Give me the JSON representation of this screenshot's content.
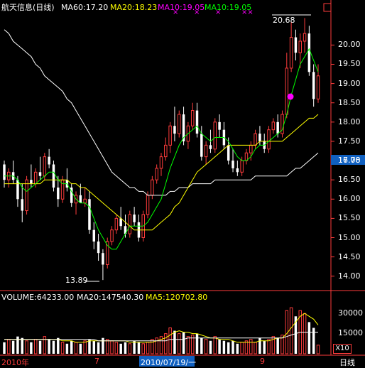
{
  "header": {
    "stock_title": "航天信息(日线)",
    "ma60": "MA60:17.20",
    "ma20": "MA20:18.23",
    "ma10a": "MA10:19.05",
    "ma10b": "MA10:19.05"
  },
  "price_axis": {
    "labels": [
      "20.00",
      "19.50",
      "19.00",
      "18.50",
      "18.00",
      "17.50",
      "17.00",
      "16.50",
      "16.00",
      "15.50",
      "15.00",
      "14.50",
      "14.00"
    ],
    "current": "16.78"
  },
  "annotations": {
    "high": "20.68",
    "low": "13.89"
  },
  "volume_header": {
    "volume": "VOLUME:64233.00",
    "ma20": "MA20:147540.30",
    "ma5": "MA5:120702.80"
  },
  "volume_axis": {
    "labels": [
      "30000",
      "15000"
    ],
    "unit_button": "X10"
  },
  "x_axis": {
    "labels": [
      "2010年",
      "7",
      "2010/07/19/一",
      "9"
    ],
    "period_button": "日线"
  },
  "colors": {
    "up": "#ff3c3c",
    "down": "#ffffff",
    "ma_white": "#ffffff",
    "ma_yellow": "#ffff00",
    "ma_green": "#00ff00",
    "magenta": "#ff00ff",
    "cyan": "#00ffff",
    "current_bg": "#1060c0"
  },
  "chart_data": {
    "type": "candlestick",
    "ylim": [
      13.7,
      20.8
    ],
    "candles": [
      [
        16.9,
        17.0,
        16.3,
        16.5
      ],
      [
        16.5,
        16.8,
        16.3,
        16.7
      ],
      [
        16.7,
        17.0,
        16.4,
        16.5
      ],
      [
        16.5,
        16.6,
        15.8,
        16.0
      ],
      [
        16.0,
        16.4,
        15.4,
        15.7
      ],
      [
        15.7,
        16.6,
        15.6,
        16.5
      ],
      [
        16.5,
        16.9,
        16.3,
        16.4
      ],
      [
        16.4,
        16.8,
        16.3,
        16.7
      ],
      [
        16.7,
        17.1,
        16.5,
        16.6
      ],
      [
        16.6,
        17.2,
        16.5,
        17.1
      ],
      [
        17.1,
        17.3,
        16.8,
        16.9
      ],
      [
        16.9,
        17.0,
        16.2,
        16.3
      ],
      [
        16.3,
        16.6,
        15.8,
        16.0
      ],
      [
        16.0,
        16.6,
        15.9,
        16.5
      ],
      [
        16.5,
        16.8,
        16.2,
        16.3
      ],
      [
        16.3,
        16.4,
        15.8,
        15.9
      ],
      [
        15.9,
        16.2,
        15.6,
        16.1
      ],
      [
        16.1,
        16.4,
        15.9,
        15.9
      ],
      [
        15.9,
        16.3,
        15.8,
        16.0
      ],
      [
        16.0,
        16.2,
        15.1,
        15.2
      ],
      [
        15.2,
        15.4,
        14.7,
        14.9
      ],
      [
        14.9,
        15.1,
        14.4,
        14.6
      ],
      [
        14.6,
        14.7,
        13.9,
        14.3
      ],
      [
        14.3,
        15.0,
        14.2,
        14.9
      ],
      [
        14.9,
        15.3,
        14.8,
        15.2
      ],
      [
        15.2,
        15.6,
        15.1,
        15.5
      ],
      [
        15.5,
        15.8,
        15.2,
        15.3
      ],
      [
        15.3,
        15.6,
        15.0,
        15.1
      ],
      [
        15.1,
        15.7,
        15.0,
        15.6
      ],
      [
        15.6,
        15.8,
        15.3,
        15.4
      ],
      [
        15.4,
        15.6,
        14.9,
        15.0
      ],
      [
        15.0,
        15.7,
        14.9,
        15.6
      ],
      [
        15.6,
        16.2,
        15.5,
        16.1
      ],
      [
        16.1,
        16.6,
        16.0,
        16.5
      ],
      [
        16.5,
        16.9,
        16.4,
        16.8
      ],
      [
        16.8,
        17.2,
        16.6,
        17.1
      ],
      [
        17.1,
        17.6,
        17.0,
        17.4
      ],
      [
        17.4,
        18.0,
        17.2,
        17.9
      ],
      [
        17.9,
        18.4,
        17.5,
        17.7
      ],
      [
        17.7,
        18.3,
        17.6,
        18.2
      ],
      [
        18.2,
        18.4,
        17.4,
        17.5
      ],
      [
        17.5,
        18.0,
        17.3,
        17.9
      ],
      [
        17.9,
        18.5,
        17.8,
        18.3
      ],
      [
        18.3,
        18.5,
        17.6,
        17.7
      ],
      [
        17.7,
        17.9,
        17.0,
        17.1
      ],
      [
        17.1,
        17.5,
        16.9,
        17.4
      ],
      [
        17.4,
        17.8,
        17.2,
        17.3
      ],
      [
        17.3,
        18.1,
        17.2,
        18.0
      ],
      [
        18.0,
        18.2,
        17.6,
        17.8
      ],
      [
        17.8,
        18.0,
        17.3,
        17.4
      ],
      [
        17.4,
        17.6,
        16.9,
        17.0
      ],
      [
        17.0,
        17.3,
        16.7,
        16.8
      ],
      [
        16.8,
        17.0,
        16.6,
        16.7
      ],
      [
        16.7,
        17.1,
        16.6,
        17.0
      ],
      [
        17.0,
        17.3,
        16.9,
        17.2
      ],
      [
        17.2,
        17.5,
        17.0,
        17.4
      ],
      [
        17.4,
        17.8,
        17.3,
        17.7
      ],
      [
        17.7,
        17.9,
        17.4,
        17.5
      ],
      [
        17.5,
        17.7,
        17.2,
        17.3
      ],
      [
        17.3,
        17.9,
        17.2,
        17.8
      ],
      [
        17.8,
        18.1,
        17.7,
        18.0
      ],
      [
        18.0,
        18.2,
        17.6,
        17.7
      ],
      [
        17.7,
        18.3,
        17.6,
        18.2
      ],
      [
        18.2,
        19.8,
        18.1,
        19.4
      ],
      [
        19.4,
        20.6,
        19.3,
        20.2
      ],
      [
        20.2,
        20.4,
        19.6,
        19.8
      ],
      [
        19.8,
        20.3,
        19.4,
        20.1
      ],
      [
        20.1,
        20.7,
        19.8,
        20.3
      ],
      [
        20.3,
        20.5,
        19.2,
        19.3
      ],
      [
        19.3,
        19.5,
        18.4,
        18.6
      ],
      [
        18.6,
        19.5,
        18.5,
        19.2
      ]
    ],
    "ma5_price": [
      16.6,
      16.6,
      16.6,
      16.5,
      16.3,
      16.2,
      16.3,
      16.4,
      16.5,
      16.6,
      16.7,
      16.7,
      16.5,
      16.4,
      16.4,
      16.2,
      16.0,
      15.9,
      15.9,
      15.8,
      15.5,
      15.2,
      15.0,
      14.8,
      14.7,
      14.7,
      14.9,
      15.1,
      15.3,
      15.3,
      15.3,
      15.3,
      15.4,
      15.6,
      15.8,
      16.0,
      16.4,
      16.8,
      17.1,
      17.4,
      17.6,
      17.7,
      17.8,
      17.9,
      17.7,
      17.6,
      17.5,
      17.6,
      17.6,
      17.6,
      17.5,
      17.3,
      17.1,
      17.0,
      17.0,
      17.1,
      17.3,
      17.4,
      17.4,
      17.5,
      17.6,
      17.7,
      17.8,
      18.2,
      18.7,
      19.1,
      19.5,
      19.7,
      19.9,
      19.6,
      19.3
    ],
    "ma20_price": [
      16.4,
      16.4,
      16.4,
      16.4,
      16.4,
      16.4,
      16.4,
      16.4,
      16.4,
      16.5,
      16.5,
      16.5,
      16.5,
      16.5,
      16.5,
      16.4,
      16.4,
      16.3,
      16.3,
      16.2,
      16.1,
      16.0,
      15.9,
      15.8,
      15.7,
      15.6,
      15.5,
      15.4,
      15.3,
      15.2,
      15.2,
      15.2,
      15.2,
      15.2,
      15.3,
      15.4,
      15.5,
      15.6,
      15.8,
      15.9,
      16.1,
      16.3,
      16.5,
      16.7,
      16.8,
      16.9,
      17.0,
      17.1,
      17.2,
      17.3,
      17.4,
      17.4,
      17.4,
      17.4,
      17.4,
      17.4,
      17.4,
      17.5,
      17.5,
      17.5,
      17.5,
      17.5,
      17.5,
      17.6,
      17.7,
      17.8,
      17.9,
      18.0,
      18.1,
      18.1,
      18.2
    ],
    "ma60_price": [
      20.4,
      20.3,
      20.1,
      20.0,
      19.9,
      19.8,
      19.7,
      19.5,
      19.4,
      19.2,
      19.1,
      19.0,
      18.9,
      18.8,
      18.6,
      18.5,
      18.3,
      18.1,
      17.9,
      17.7,
      17.5,
      17.3,
      17.1,
      16.9,
      16.7,
      16.6,
      16.5,
      16.4,
      16.3,
      16.3,
      16.2,
      16.2,
      16.1,
      16.1,
      16.1,
      16.1,
      16.1,
      16.2,
      16.2,
      16.3,
      16.3,
      16.3,
      16.4,
      16.4,
      16.4,
      16.4,
      16.4,
      16.5,
      16.5,
      16.5,
      16.5,
      16.5,
      16.5,
      16.5,
      16.5,
      16.5,
      16.6,
      16.6,
      16.6,
      16.6,
      16.6,
      16.6,
      16.6,
      16.6,
      16.7,
      16.8,
      16.8,
      16.9,
      17.0,
      17.1,
      17.2
    ],
    "volume": [
      8,
      10,
      9,
      12,
      11,
      9,
      8,
      10,
      9,
      12,
      10,
      9,
      11,
      8,
      7,
      9,
      8,
      7,
      9,
      10,
      9,
      8,
      11,
      10,
      9,
      8,
      7,
      8,
      7,
      9,
      8,
      7,
      8,
      10,
      11,
      12,
      14,
      18,
      16,
      14,
      15,
      12,
      13,
      14,
      11,
      10,
      9,
      12,
      10,
      9,
      8,
      9,
      7,
      8,
      9,
      10,
      8,
      11,
      9,
      10,
      12,
      11,
      13,
      30,
      32,
      26,
      30,
      28,
      22,
      18,
      6
    ],
    "vol_ma5": [
      10,
      10,
      10,
      10,
      10,
      10,
      10,
      10,
      10,
      10,
      10,
      10,
      10,
      9,
      9,
      9,
      8,
      8,
      8,
      9,
      9,
      9,
      9,
      9,
      9,
      9,
      9,
      9,
      8,
      8,
      8,
      8,
      8,
      8,
      9,
      10,
      11,
      13,
      15,
      16,
      15,
      15,
      14,
      14,
      13,
      12,
      11,
      11,
      10,
      10,
      10,
      9,
      8,
      8,
      8,
      8,
      8,
      9,
      9,
      9,
      10,
      11,
      11,
      14,
      18,
      22,
      26,
      28,
      26,
      24,
      20
    ],
    "vol_ma20": [
      10,
      10,
      10,
      10,
      10,
      10,
      10,
      10,
      10,
      10,
      10,
      10,
      10,
      10,
      10,
      10,
      10,
      10,
      10,
      10,
      10,
      9,
      9,
      9,
      9,
      9,
      9,
      9,
      9,
      9,
      9,
      9,
      9,
      9,
      9,
      9,
      9,
      10,
      10,
      10,
      10,
      11,
      11,
      11,
      11,
      11,
      11,
      11,
      11,
      11,
      11,
      11,
      11,
      11,
      11,
      11,
      11,
      11,
      11,
      11,
      11,
      11,
      11,
      12,
      13,
      14,
      15,
      15,
      15,
      15,
      15
    ]
  }
}
